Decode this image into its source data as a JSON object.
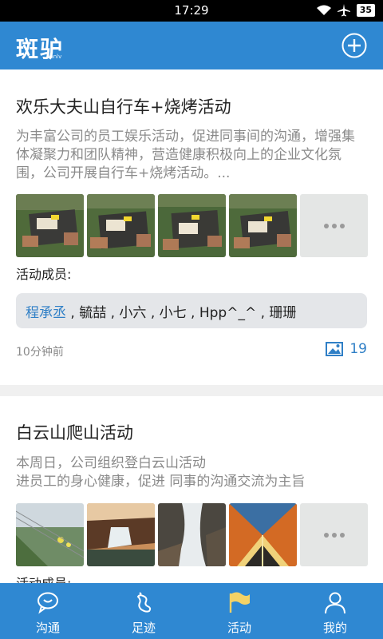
{
  "status": {
    "time": "17:29",
    "battery": "35"
  },
  "app": {
    "logo": "斑驴",
    "logo_sub": "banlv"
  },
  "activities": [
    {
      "title": "欢乐大夫山自行车+烧烤活动",
      "description": "为丰富公司的员工娱乐活动，促进同事间的沟通，增强集体凝聚力和团队精神，营造健康积极向上的企业文化氛围，公司开展自行车+烧烤活动。...",
      "members_label": "活动成员:",
      "members_first": "程承丞",
      "members_rest": " , 毓喆 , 小六 , 小七 , Hpp^_^ , 珊珊",
      "time_ago": "10分钟前",
      "photo_count": "19"
    },
    {
      "title": "白云山爬山活动",
      "description": "本周日，公司组织登白云山活动\n进员工的身心健康，促进 同事的沟通交流为主旨",
      "members_label": "活动成员:"
    }
  ],
  "tabs": [
    {
      "label": "沟通",
      "icon": "chat-icon"
    },
    {
      "label": "足迹",
      "icon": "footprint-icon"
    },
    {
      "label": "活动",
      "icon": "flag-icon"
    },
    {
      "label": "我的",
      "icon": "person-icon"
    }
  ],
  "colors": {
    "primary": "#2f88d2",
    "link": "#2f7fc6"
  }
}
